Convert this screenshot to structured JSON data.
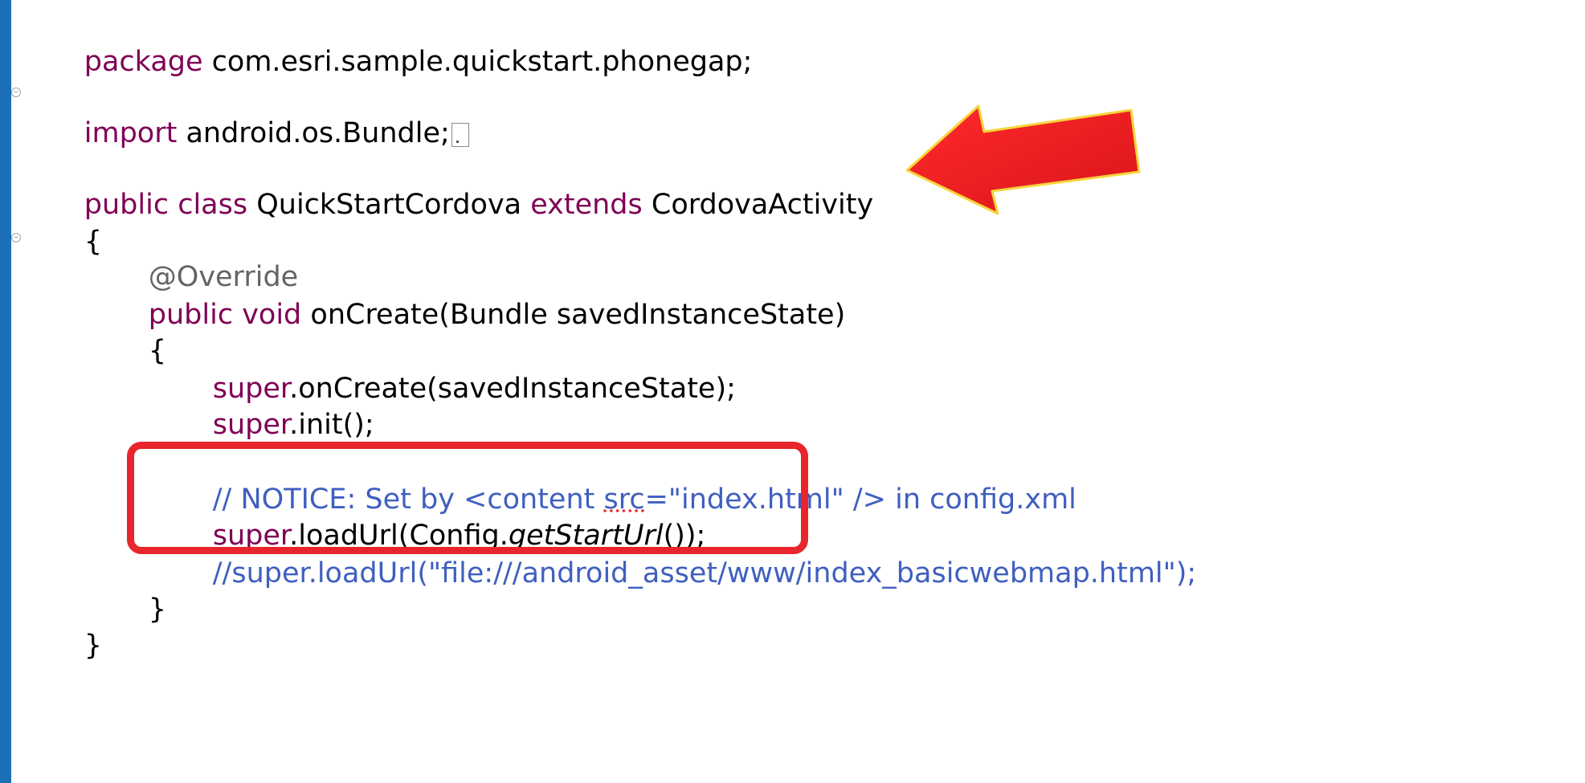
{
  "editor": {
    "lines": {
      "package_kw": "package",
      "package_name": " com.esri.sample.quickstart.phonegap;",
      "import_kw": "import",
      "import_name": " android.os.Bundle;",
      "class_public": "public",
      "class_class": " class",
      "class_name": " QuickStartCordova ",
      "class_extends": "extends",
      "class_parent": " CordovaActivity",
      "open_brace": "{",
      "annotation": "@Override",
      "method_public": "public",
      "method_void": " void",
      "method_sig": " onCreate(Bundle savedInstanceState)",
      "method_open": "{",
      "super_oncreate_kw": "super",
      "super_oncreate_rest": ".onCreate(savedInstanceState);",
      "super_init_kw": "super",
      "super_init_rest": ".init();",
      "comment_notice_pre": "// NOTICE: Set by <content ",
      "comment_notice_src": "src",
      "comment_notice_post": "=\"index.html\" /> in config.xml",
      "loadurl_kw": "super",
      "loadurl_pre": ".loadUrl(Config.",
      "loadurl_method": "getStartUrl",
      "loadurl_post": "());",
      "comment_loadurl": "//super.loadUrl(\"file:///android_asset/www/index_basicwebmap.html\");",
      "method_close": "}",
      "class_close": "}"
    }
  },
  "colors": {
    "keyword": "#7f0055",
    "comment": "#3f5fbf",
    "annotation": "#646464",
    "highlight": "#e8252c",
    "arrow": "#ee1c24",
    "sidebar": "#1d6fb8"
  },
  "icons": {
    "fold": "fold-marker-icon",
    "arrow": "red-arrow-icon"
  }
}
